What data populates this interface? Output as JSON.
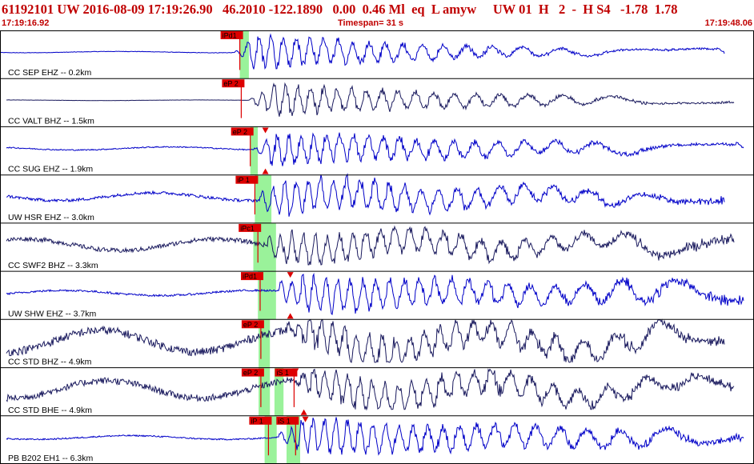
{
  "header": {
    "title": "61192101 UW 2016-08-09 17:19:26.90   46.2010 -122.1890   0.00  0.46 Ml  eq  L amyw     UW 01  H   2  -  H S4   -1.78  1.78",
    "start_time": "17:19:16.92",
    "timespan": "Timespan=  31 s",
    "end_time": "17:19:48.06"
  },
  "colors": {
    "frame": "#000000",
    "blue_trace": "#0000c8",
    "dark_trace": "#1a1a5e",
    "pick_box": "#dd0000",
    "pick_text": "#000000",
    "window": "#9af29a"
  },
  "chart_data": {
    "type": "line",
    "title": "",
    "x_range": [
      17.19,
      48.06
    ],
    "traces": [
      {
        "label": "CC SEP EHZ -- 0.2km",
        "color": "blue",
        "gain": 1.0,
        "noise": 0.02,
        "onset": 0.31,
        "picks": [
          {
            "text": "iPd1",
            "t": 0.318,
            "win": [
              0.318,
              0.33
            ]
          }
        ],
        "ticks": []
      },
      {
        "label": "CC VALT BHZ -- 1.5km",
        "color": "dark",
        "gain": 0.9,
        "noise": 0.01,
        "onset": 0.33,
        "picks": [
          {
            "text": "eP 2",
            "t": 0.32,
            "win": null
          }
        ],
        "ticks": []
      },
      {
        "label": "CC SUG EHZ -- 1.9km",
        "color": "blue",
        "gain": 0.95,
        "noise": 0.05,
        "onset": 0.335,
        "picks": [
          {
            "text": "eP 2",
            "t": 0.332,
            "win": [
              0.332,
              0.342
            ]
          }
        ],
        "ticks": [
          {
            "t": 0.352,
            "dir": "down"
          }
        ]
      },
      {
        "label": "UW HSR EHZ -- 3.0km",
        "color": "blue",
        "gain": 1.0,
        "noise": 0.12,
        "onset": 0.345,
        "picks": [
          {
            "text": "iP 1",
            "t": 0.338,
            "win": [
              0.338,
              0.36
            ]
          }
        ],
        "ticks": [
          {
            "t": 0.352,
            "dir": "up"
          }
        ]
      },
      {
        "label": "CC SWF2 BHZ -- 3.3km",
        "color": "dark",
        "gain": 0.9,
        "noise": 0.2,
        "onset": 0.355,
        "picks": [
          {
            "text": "iPc1",
            "t": 0.342,
            "win": [
              0.336,
              0.366
            ]
          }
        ],
        "ticks": []
      },
      {
        "label": "UW SHW EHZ -- 3.7km",
        "color": "blue",
        "gain": 1.0,
        "noise": 0.08,
        "onset": 0.37,
        "picks": [
          {
            "text": "iPd1",
            "t": 0.345,
            "win": [
              0.342,
              0.366
            ]
          }
        ],
        "ticks": [
          {
            "t": 0.385,
            "dir": "down"
          }
        ]
      },
      {
        "label": "CC STD BHZ -- 4.9km",
        "color": "dark",
        "gain": 0.95,
        "noise": 0.35,
        "onset": 0.38,
        "picks": [
          {
            "text": "eP 2",
            "t": 0.346,
            "win": [
              0.343,
              0.358
            ]
          }
        ],
        "ticks": [
          {
            "t": 0.385,
            "dir": "up"
          }
        ]
      },
      {
        "label": "CC STD BHE -- 4.9km",
        "color": "dark",
        "gain": 0.9,
        "noise": 0.3,
        "onset": 0.385,
        "picks": [
          {
            "text": "eP 2",
            "t": 0.346,
            "win": [
              0.343,
              0.358
            ]
          },
          {
            "text": "iS 1",
            "t": 0.39,
            "win": [
              0.364,
              0.376
            ]
          }
        ],
        "ticks": [
          {
            "t": 0.392,
            "dir": "down"
          }
        ]
      },
      {
        "label": "PB B202 EH1 -- 6.3km",
        "color": "blue",
        "gain": 0.95,
        "noise": 0.06,
        "onset": 0.37,
        "picks": [
          {
            "text": "iP 1",
            "t": 0.356,
            "win": [
              0.351,
              0.367
            ]
          },
          {
            "text": "iS 1",
            "t": 0.392,
            "win": [
              0.38,
              0.398
            ]
          }
        ],
        "ticks": [
          {
            "t": 0.405,
            "dir": "down"
          },
          {
            "t": 0.403,
            "dir": "up"
          }
        ]
      }
    ]
  }
}
